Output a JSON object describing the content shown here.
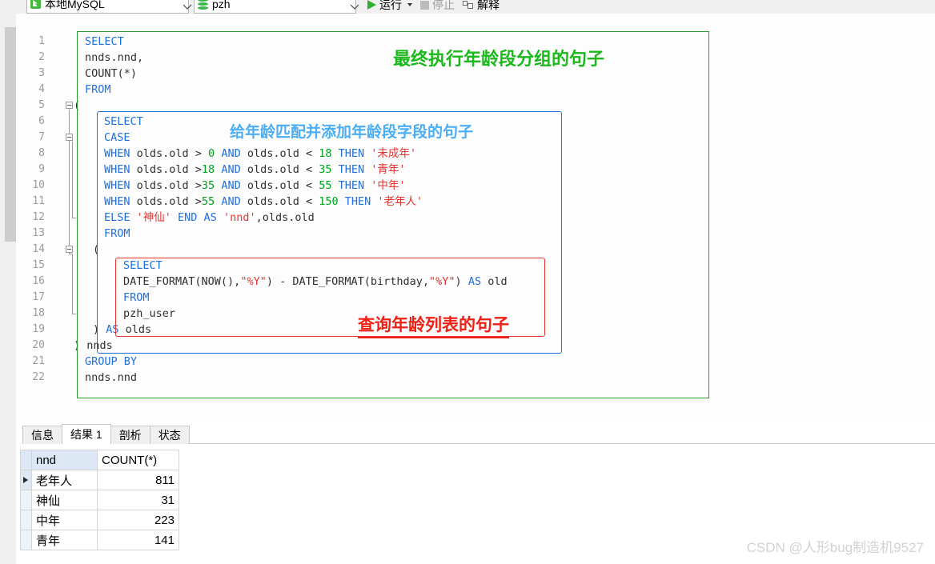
{
  "toolbar": {
    "connection": {
      "icon": "connection-icon",
      "label": "本地MySQL"
    },
    "database": {
      "icon": "database-icon",
      "label": "pzh"
    },
    "run": {
      "icon": "play-icon",
      "label": "运行",
      "dropdown": "caret-down-icon"
    },
    "stop": {
      "icon": "stop-icon",
      "label": "停止",
      "enabled": false
    },
    "explain": {
      "icon": "explain-icon",
      "label": "解释"
    }
  },
  "editor": {
    "lines": [
      {
        "n": "1",
        "tokens": [
          {
            "t": "SELECT",
            "c": "kw"
          }
        ]
      },
      {
        "n": "2",
        "tokens": [
          {
            "t": "nnds.nnd,",
            "c": "pl"
          }
        ]
      },
      {
        "n": "3",
        "tokens": [
          {
            "t": "COUNT(*)",
            "c": "pl"
          }
        ]
      },
      {
        "n": "4",
        "tokens": [
          {
            "t": "FROM",
            "c": "kw"
          }
        ]
      },
      {
        "n": "5",
        "tokens": [
          {
            "t": "(",
            "c": "pl"
          }
        ]
      },
      {
        "n": "6",
        "tokens": [
          {
            "t": "SELECT",
            "c": "kw"
          }
        ]
      },
      {
        "n": "7",
        "tokens": [
          {
            "t": "CASE",
            "c": "kw"
          }
        ]
      },
      {
        "n": "8",
        "tokens": [
          {
            "t": "WHEN ",
            "c": "kw"
          },
          {
            "t": "olds.old > ",
            "c": "pl"
          },
          {
            "t": "0",
            "c": "num"
          },
          {
            "t": " ",
            "c": "pl"
          },
          {
            "t": "AND ",
            "c": "kw"
          },
          {
            "t": "olds.old < ",
            "c": "pl"
          },
          {
            "t": "18",
            "c": "num"
          },
          {
            "t": " ",
            "c": "pl"
          },
          {
            "t": "THEN ",
            "c": "kw"
          },
          {
            "t": "'未成年'",
            "c": "str"
          }
        ]
      },
      {
        "n": "9",
        "tokens": [
          {
            "t": "WHEN ",
            "c": "kw"
          },
          {
            "t": "olds.old >",
            "c": "pl"
          },
          {
            "t": "18",
            "c": "num"
          },
          {
            "t": " ",
            "c": "pl"
          },
          {
            "t": "AND ",
            "c": "kw"
          },
          {
            "t": "olds.old < ",
            "c": "pl"
          },
          {
            "t": "35",
            "c": "num"
          },
          {
            "t": " ",
            "c": "pl"
          },
          {
            "t": "THEN ",
            "c": "kw"
          },
          {
            "t": "'青年'",
            "c": "str"
          }
        ]
      },
      {
        "n": "10",
        "tokens": [
          {
            "t": "WHEN ",
            "c": "kw"
          },
          {
            "t": "olds.old >",
            "c": "pl"
          },
          {
            "t": "35",
            "c": "num"
          },
          {
            "t": " ",
            "c": "pl"
          },
          {
            "t": "AND ",
            "c": "kw"
          },
          {
            "t": "olds.old < ",
            "c": "pl"
          },
          {
            "t": "55",
            "c": "num"
          },
          {
            "t": " ",
            "c": "pl"
          },
          {
            "t": "THEN ",
            "c": "kw"
          },
          {
            "t": "'中年'",
            "c": "str"
          }
        ]
      },
      {
        "n": "11",
        "tokens": [
          {
            "t": "WHEN ",
            "c": "kw"
          },
          {
            "t": "olds.old >",
            "c": "pl"
          },
          {
            "t": "55",
            "c": "num"
          },
          {
            "t": " ",
            "c": "pl"
          },
          {
            "t": "AND ",
            "c": "kw"
          },
          {
            "t": "olds.old < ",
            "c": "pl"
          },
          {
            "t": "150",
            "c": "num"
          },
          {
            "t": " ",
            "c": "pl"
          },
          {
            "t": "THEN ",
            "c": "kw"
          },
          {
            "t": "'老年人'",
            "c": "str"
          }
        ]
      },
      {
        "n": "12",
        "tokens": [
          {
            "t": "ELSE ",
            "c": "kw"
          },
          {
            "t": "'神仙'",
            "c": "str"
          },
          {
            "t": " ",
            "c": "pl"
          },
          {
            "t": "END AS ",
            "c": "kw"
          },
          {
            "t": "'nnd'",
            "c": "str"
          },
          {
            "t": ",olds.old",
            "c": "pl"
          }
        ]
      },
      {
        "n": "13",
        "tokens": [
          {
            "t": "FROM",
            "c": "kw"
          }
        ]
      },
      {
        "n": "14",
        "tokens": [
          {
            "t": "(",
            "c": "pl"
          }
        ]
      },
      {
        "n": "15",
        "tokens": [
          {
            "t": "SELECT",
            "c": "kw"
          }
        ]
      },
      {
        "n": "16",
        "tokens": [
          {
            "t": "DATE_FORMAT(NOW(),",
            "c": "pl"
          },
          {
            "t": "\"%Y\"",
            "c": "str"
          },
          {
            "t": ") - DATE_FORMAT(birthday,",
            "c": "pl"
          },
          {
            "t": "\"%Y\"",
            "c": "str"
          },
          {
            "t": ") ",
            "c": "pl"
          },
          {
            "t": "AS ",
            "c": "kw"
          },
          {
            "t": "old",
            "c": "pl"
          }
        ]
      },
      {
        "n": "17",
        "tokens": [
          {
            "t": "FROM",
            "c": "kw"
          }
        ]
      },
      {
        "n": "18",
        "tokens": [
          {
            "t": "pzh_user",
            "c": "pl"
          }
        ]
      },
      {
        "n": "19",
        "tokens": [
          {
            "t": ") ",
            "c": "pl"
          },
          {
            "t": "AS ",
            "c": "kw"
          },
          {
            "t": "olds",
            "c": "pl"
          }
        ]
      },
      {
        "n": "20",
        "tokens": [
          {
            "t": ") ",
            "c": "pl"
          },
          {
            "t": "nnds",
            "c": "pl"
          }
        ]
      },
      {
        "n": "21",
        "tokens": [
          {
            "t": "GROUP BY",
            "c": "kw"
          }
        ]
      },
      {
        "n": "22",
        "tokens": [
          {
            "t": "nnds.nnd",
            "c": "pl"
          }
        ]
      }
    ],
    "annotations": {
      "outer": "最终执行年龄段分组的句子",
      "middle": "给年龄匹配并添加年龄段字段的句子",
      "inner": "查询年龄列表的句子"
    },
    "colors": {
      "outer_box": "#2a9c2a",
      "middle_box": "#1f6fe0",
      "inner_box": "#e8322e",
      "keyword": "#1f6fe0",
      "number": "#00a21c",
      "string": "#e8322e"
    }
  },
  "results": {
    "tabs": [
      {
        "label": "信息",
        "active": false
      },
      {
        "label": "结果 1",
        "active": true
      },
      {
        "label": "剖析",
        "active": false
      },
      {
        "label": "状态",
        "active": false
      }
    ],
    "grid": {
      "columns": [
        "nnd",
        "COUNT(*)"
      ],
      "rows": [
        {
          "nnd": "老年人",
          "count": "811",
          "current": true
        },
        {
          "nnd": "神仙",
          "count": "31",
          "current": false
        },
        {
          "nnd": "中年",
          "count": "223",
          "current": false
        },
        {
          "nnd": "青年",
          "count": "141",
          "current": false
        }
      ]
    }
  },
  "watermark": "CSDN @人形bug制造机9527"
}
